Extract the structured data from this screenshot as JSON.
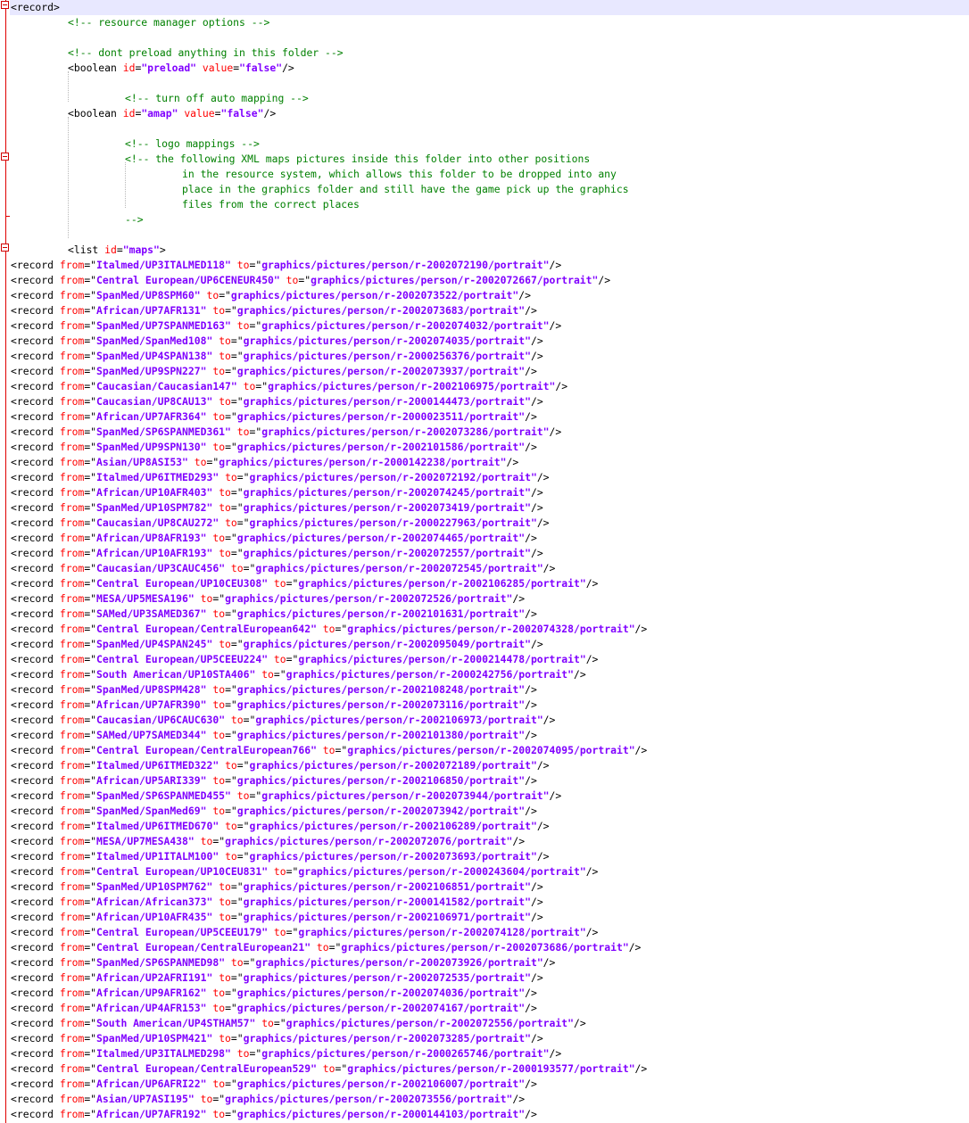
{
  "colors": {
    "tag": "#000000",
    "attribute": "#ff0000",
    "value": "#8000ff",
    "comment": "#008000",
    "fold": "#e00000",
    "current_line": "#e8e8ff"
  },
  "header_lines": [
    {
      "indent": 0,
      "parts": [
        [
          "tag",
          "<record>"
        ]
      ]
    },
    {
      "indent": 8,
      "parts": [
        [
          "cmt",
          "<!-- resource manager options -->"
        ]
      ]
    },
    {
      "indent": 0,
      "parts": []
    },
    {
      "indent": 8,
      "parts": [
        [
          "cmt",
          "<!-- dont preload anything in this folder -->"
        ]
      ]
    },
    {
      "indent": 8,
      "parts": [
        [
          "tag",
          "<boolean "
        ],
        [
          "attr",
          "id"
        ],
        [
          "tag",
          "="
        ],
        [
          "val",
          "\"preload\""
        ],
        [
          "tag",
          " "
        ],
        [
          "attr",
          "value"
        ],
        [
          "tag",
          "="
        ],
        [
          "val",
          "\"false\""
        ],
        [
          "tag",
          "/>"
        ]
      ]
    },
    {
      "indent": 0,
      "parts": []
    },
    {
      "indent": 16,
      "parts": [
        [
          "cmt",
          "<!-- turn off auto mapping -->"
        ]
      ]
    },
    {
      "indent": 8,
      "parts": [
        [
          "tag",
          "<boolean "
        ],
        [
          "attr",
          "id"
        ],
        [
          "tag",
          "="
        ],
        [
          "val",
          "\"amap\""
        ],
        [
          "tag",
          " "
        ],
        [
          "attr",
          "value"
        ],
        [
          "tag",
          "="
        ],
        [
          "val",
          "\"false\""
        ],
        [
          "tag",
          "/>"
        ]
      ]
    },
    {
      "indent": 0,
      "parts": []
    },
    {
      "indent": 16,
      "parts": [
        [
          "cmt",
          "<!-- logo mappings -->"
        ]
      ]
    },
    {
      "indent": 16,
      "parts": [
        [
          "cmt",
          "<!-- the following XML maps pictures inside this folder into other positions"
        ]
      ]
    },
    {
      "indent": 24,
      "parts": [
        [
          "cmt",
          "in the resource system, which allows this folder to be dropped into any"
        ]
      ]
    },
    {
      "indent": 24,
      "parts": [
        [
          "cmt",
          "place in the graphics folder and still have the game pick up the graphics"
        ]
      ]
    },
    {
      "indent": 24,
      "parts": [
        [
          "cmt",
          "files from the correct places"
        ]
      ]
    },
    {
      "indent": 16,
      "parts": [
        [
          "cmt",
          "-->"
        ]
      ]
    },
    {
      "indent": 0,
      "parts": []
    },
    {
      "indent": 8,
      "parts": [
        [
          "tag",
          "<list "
        ],
        [
          "attr",
          "id"
        ],
        [
          "tag",
          "="
        ],
        [
          "val",
          "\"maps\""
        ],
        [
          "tag",
          ">"
        ]
      ]
    }
  ],
  "records": [
    [
      "Italmed/UP3ITALMED118",
      "graphics/pictures/person/r-2002072190/portrait"
    ],
    [
      "Central European/UP6CENEUR450",
      "graphics/pictures/person/r-2002072667/portrait"
    ],
    [
      "SpanMed/UP8SPM60",
      "graphics/pictures/person/r-2002073522/portrait"
    ],
    [
      "African/UP7AFR131",
      "graphics/pictures/person/r-2002073683/portrait"
    ],
    [
      "SpanMed/UP7SPANMED163",
      "graphics/pictures/person/r-2002074032/portrait"
    ],
    [
      "SpanMed/SpanMed108",
      "graphics/pictures/person/r-2002074035/portrait"
    ],
    [
      "SpanMed/UP4SPAN138",
      "graphics/pictures/person/r-2000256376/portrait"
    ],
    [
      "SpanMed/UP9SPN227",
      "graphics/pictures/person/r-2002073937/portrait"
    ],
    [
      "Caucasian/Caucasian147",
      "graphics/pictures/person/r-2002106975/portrait"
    ],
    [
      "Caucasian/UP8CAU13",
      "graphics/pictures/person/r-2000144473/portrait"
    ],
    [
      "African/UP7AFR364",
      "graphics/pictures/person/r-2000023511/portrait"
    ],
    [
      "SpanMed/SP6SPANMED361",
      "graphics/pictures/person/r-2002073286/portrait"
    ],
    [
      "SpanMed/UP9SPN130",
      "graphics/pictures/person/r-2002101586/portrait"
    ],
    [
      "Asian/UP8ASI53",
      "graphics/pictures/person/r-2000142238/portrait"
    ],
    [
      "Italmed/UP6ITMED293",
      "graphics/pictures/person/r-2002072192/portrait"
    ],
    [
      "African/UP10AFR403",
      "graphics/pictures/person/r-2002074245/portrait"
    ],
    [
      "SpanMed/UP10SPM782",
      "graphics/pictures/person/r-2002073419/portrait"
    ],
    [
      "Caucasian/UP8CAU272",
      "graphics/pictures/person/r-2000227963/portrait"
    ],
    [
      "African/UP8AFR193",
      "graphics/pictures/person/r-2002074465/portrait"
    ],
    [
      "African/UP10AFR193",
      "graphics/pictures/person/r-2002072557/portrait"
    ],
    [
      "Caucasian/UP3CAUC456",
      "graphics/pictures/person/r-2002072545/portrait"
    ],
    [
      "Central European/UP10CEU308",
      "graphics/pictures/person/r-2002106285/portrait"
    ],
    [
      "MESA/UP5MESA196",
      "graphics/pictures/person/r-2002072526/portrait"
    ],
    [
      "SAMed/UP3SAMED367",
      "graphics/pictures/person/r-2002101631/portrait"
    ],
    [
      "Central European/CentralEuropean642",
      "graphics/pictures/person/r-2002074328/portrait"
    ],
    [
      "SpanMed/UP4SPAN245",
      "graphics/pictures/person/r-2002095049/portrait"
    ],
    [
      "Central European/UP5CEEU224",
      "graphics/pictures/person/r-2000214478/portrait"
    ],
    [
      "South American/UP10STA406",
      "graphics/pictures/person/r-2000242756/portrait"
    ],
    [
      "SpanMed/UP8SPM428",
      "graphics/pictures/person/r-2002108248/portrait"
    ],
    [
      "African/UP7AFR390",
      "graphics/pictures/person/r-2002073116/portrait"
    ],
    [
      "Caucasian/UP6CAUC630",
      "graphics/pictures/person/r-2002106973/portrait"
    ],
    [
      "SAMed/UP7SAMED344",
      "graphics/pictures/person/r-2002101380/portrait"
    ],
    [
      "Central European/CentralEuropean766",
      "graphics/pictures/person/r-2002074095/portrait"
    ],
    [
      "Italmed/UP6ITMED322",
      "graphics/pictures/person/r-2002072189/portrait"
    ],
    [
      "African/UP5ARI339",
      "graphics/pictures/person/r-2002106850/portrait"
    ],
    [
      "SpanMed/SP6SPANMED455",
      "graphics/pictures/person/r-2002073944/portrait"
    ],
    [
      "SpanMed/SpanMed69",
      "graphics/pictures/person/r-2002073942/portrait"
    ],
    [
      "Italmed/UP6ITMED670",
      "graphics/pictures/person/r-2002106289/portrait"
    ],
    [
      "MESA/UP7MESA438",
      "graphics/pictures/person/r-2002072076/portrait"
    ],
    [
      "Italmed/UP1ITALM100",
      "graphics/pictures/person/r-2002073693/portrait"
    ],
    [
      "Central European/UP10CEU831",
      "graphics/pictures/person/r-2000243604/portrait"
    ],
    [
      "SpanMed/UP10SPM762",
      "graphics/pictures/person/r-2002106851/portrait"
    ],
    [
      "African/African373",
      "graphics/pictures/person/r-2000141582/portrait"
    ],
    [
      "African/UP10AFR435",
      "graphics/pictures/person/r-2002106971/portrait"
    ],
    [
      "Central European/UP5CEEU179",
      "graphics/pictures/person/r-2002074128/portrait"
    ],
    [
      "Central European/CentralEuropean21",
      "graphics/pictures/person/r-2002073686/portrait"
    ],
    [
      "SpanMed/SP6SPANMED98",
      "graphics/pictures/person/r-2002073926/portrait"
    ],
    [
      "African/UP2AFRI191",
      "graphics/pictures/person/r-2002072535/portrait"
    ],
    [
      "African/UP9AFR162",
      "graphics/pictures/person/r-2002074036/portrait"
    ],
    [
      "African/UP4AFR153",
      "graphics/pictures/person/r-2002074167/portrait"
    ],
    [
      "South American/UP4STHAM57",
      "graphics/pictures/person/r-2002072556/portrait"
    ],
    [
      "SpanMed/UP10SPM421",
      "graphics/pictures/person/r-2002073285/portrait"
    ],
    [
      "Italmed/UP3ITALMED298",
      "graphics/pictures/person/r-2000265746/portrait"
    ],
    [
      "Central European/CentralEuropean529",
      "graphics/pictures/person/r-2000193577/portrait"
    ],
    [
      "African/UP6AFRI22",
      "graphics/pictures/person/r-2002106007/portrait"
    ],
    [
      "Asian/UP7ASI195",
      "graphics/pictures/person/r-2002073556/portrait"
    ],
    [
      "African/UP7AFR192",
      "graphics/pictures/person/r-2000144103/portrait"
    ]
  ],
  "record_syntax": {
    "open": "<record ",
    "from_attr": "from",
    "to_attr": "to",
    "close": "/>"
  }
}
